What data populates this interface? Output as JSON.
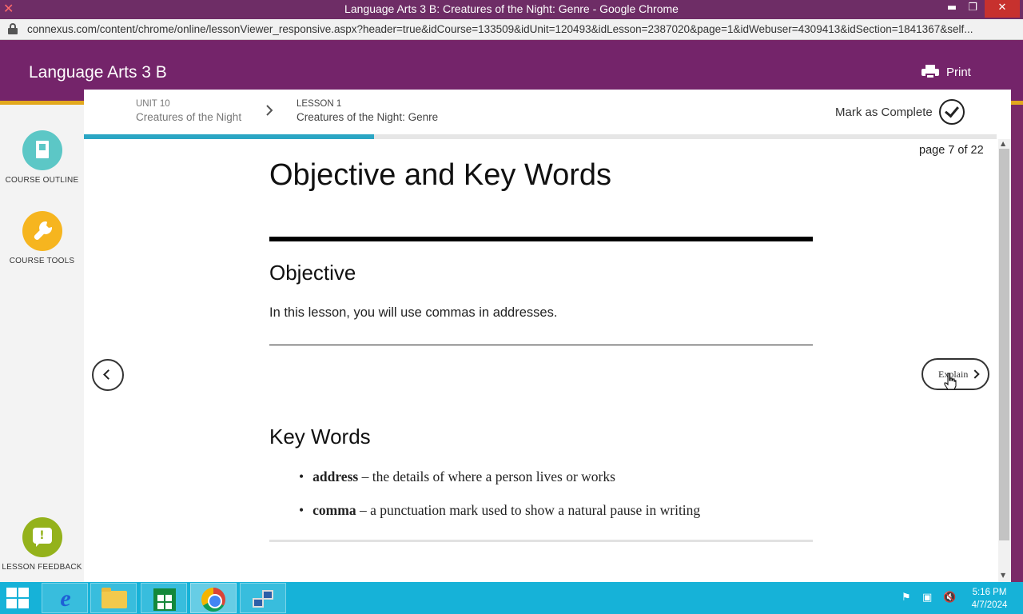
{
  "browser": {
    "window_title": "Language Arts 3 B: Creatures of the Night: Genre - Google Chrome",
    "url": "connexus.com/content/chrome/online/lessonViewer_responsive.aspx?header=true&idCourse=133509&idUnit=120493&idLesson=2387020&page=1&idWebuser=4309413&idSection=1841367&self...",
    "buttons": {
      "minimize": "▬",
      "maximize": "❐",
      "close": "✕"
    }
  },
  "header": {
    "course_title": "Language Arts 3 B",
    "print_label": "Print"
  },
  "sidebar": {
    "items": [
      {
        "label": "COURSE OUTLINE",
        "icon": "book-icon",
        "color": "#5cc7c6"
      },
      {
        "label": "COURSE TOOLS",
        "icon": "wrench-icon",
        "color": "#f6b51f"
      },
      {
        "label": "LESSON FEEDBACK",
        "icon": "chat-icon",
        "color": "#94b21b"
      }
    ]
  },
  "breadcrumb": {
    "unit_kicker": "UNIT 10",
    "unit_name": "Creatures of the Night",
    "lesson_kicker": "LESSON 1",
    "lesson_name": "Creatures of the Night: Genre"
  },
  "mark_complete_label": "Mark as Complete",
  "progress": {
    "fraction": 0.318,
    "color": "#2ba6c4"
  },
  "page_counter": "page 7 of 22",
  "content": {
    "title": "Objective and Key Words",
    "objective_heading": "Objective",
    "objective_text": "In this lesson, you will use commas in addresses.",
    "keywords_heading": "Key Words",
    "keywords": [
      {
        "term": "address",
        "definition": " – the details of where a person lives or works"
      },
      {
        "term": "comma",
        "definition": " – a punctuation mark used to show a natural pause in writing"
      }
    ]
  },
  "navigation": {
    "next_label": "Explain"
  },
  "taskbar": {
    "apps": [
      "internet-explorer-icon",
      "file-explorer-icon",
      "store-icon",
      "chrome-icon",
      "network-icon"
    ],
    "active_app": "chrome-icon",
    "time": "5:16 PM",
    "date": "4/7/2024"
  },
  "colors": {
    "brand_purple": "#74246a",
    "accent_gold": "#e2a81d",
    "taskbar": "#16b2d8"
  }
}
